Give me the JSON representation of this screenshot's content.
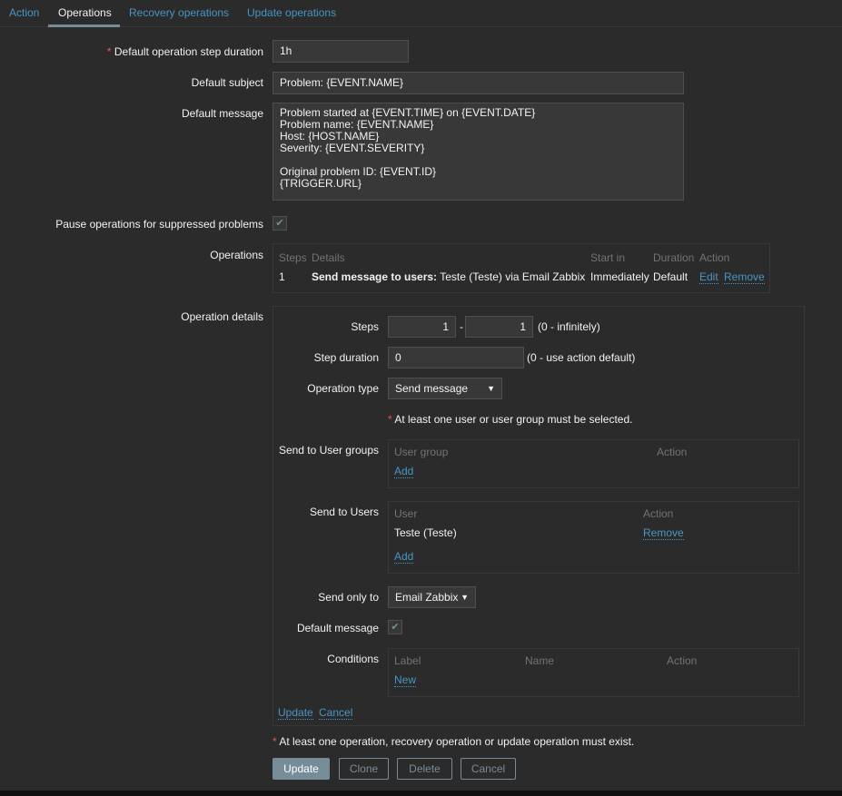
{
  "tabs": [
    "Action",
    "Operations",
    "Recovery operations",
    "Update operations"
  ],
  "form": {
    "step_duration_label": "Default operation step duration",
    "step_duration": "1h",
    "subject_label": "Default subject",
    "subject": "Problem: {EVENT.NAME}",
    "message_label": "Default message",
    "message": "Problem started at {EVENT.TIME} on {EVENT.DATE}\nProblem name: {EVENT.NAME}\nHost: {HOST.NAME}\nSeverity: {EVENT.SEVERITY}\n\nOriginal problem ID: {EVENT.ID}\n{TRIGGER.URL}",
    "pause_label": "Pause operations for suppressed problems",
    "pause_checked": true,
    "operations_label": "Operations",
    "operations_headers": [
      "Steps",
      "Details",
      "Start in",
      "Duration",
      "Action"
    ],
    "operations_rows": [
      {
        "steps": "1",
        "details_bold": "Send message to users:",
        "details": "Teste (Teste) via Email Zabbix",
        "start_in": "Immediately",
        "duration": "Default",
        "edit": "Edit",
        "remove": "Remove"
      }
    ],
    "details_label": "Operation details"
  },
  "details": {
    "steps_label": "Steps",
    "steps_from": "1",
    "steps_sep": "-",
    "steps_to": "1",
    "steps_hint": "(0 - infinitely)",
    "step_duration_label": "Step duration",
    "step_duration": "0",
    "step_duration_hint": "(0 - use action default)",
    "op_type_label": "Operation type",
    "op_type": "Send message",
    "warning": "At least one user or user group must be selected.",
    "groups_label": "Send to User groups",
    "groups_headers": [
      "User group",
      "Action"
    ],
    "groups_add": "Add",
    "users_label": "Send to Users",
    "users_headers": [
      "User",
      "Action"
    ],
    "users_rows": [
      {
        "user": "Teste (Teste)",
        "remove": "Remove"
      }
    ],
    "users_add": "Add",
    "send_only_label": "Send only to",
    "send_only": "Email Zabbix",
    "default_msg_label": "Default message",
    "default_msg_checked": true,
    "conditions_label": "Conditions",
    "conditions_headers": [
      "Label",
      "Name",
      "Action"
    ],
    "conditions_new": "New",
    "update": "Update",
    "cancel": "Cancel"
  },
  "footer": {
    "note": "At least one operation, recovery operation or update operation must exist.",
    "buttons": [
      "Update",
      "Clone",
      "Delete",
      "Cancel"
    ]
  },
  "colors": {
    "link": "#4796c4",
    "required": "#e45959",
    "primary": "#768d99"
  }
}
